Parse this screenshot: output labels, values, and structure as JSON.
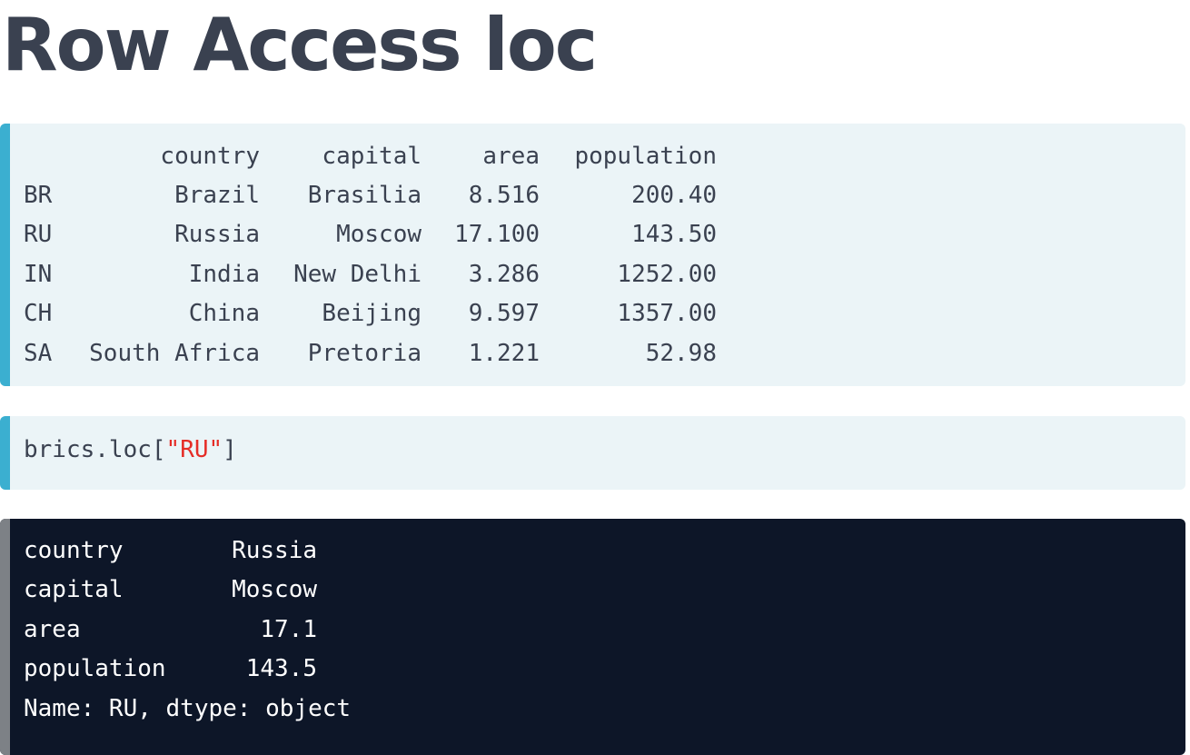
{
  "slide": {
    "title": "Row Access loc"
  },
  "dataframe": {
    "columns": [
      "country",
      "capital",
      "area",
      "population"
    ],
    "rows": [
      {
        "index": "BR",
        "country": "Brazil",
        "capital": "Brasilia",
        "area": "8.516",
        "population": "200.40"
      },
      {
        "index": "RU",
        "country": "Russia",
        "capital": "Moscow",
        "area": "17.100",
        "population": "143.50"
      },
      {
        "index": "IN",
        "country": "India",
        "capital": "New Delhi",
        "area": "3.286",
        "population": "1252.00"
      },
      {
        "index": "CH",
        "country": "China",
        "capital": "Beijing",
        "area": "9.597",
        "population": "1357.00"
      },
      {
        "index": "SA",
        "country": "South Africa",
        "capital": "Pretoria",
        "area": "1.221",
        "population": "52.98"
      }
    ]
  },
  "code": {
    "prefix": "brics.loc[",
    "string": "\"RU\"",
    "suffix": "]"
  },
  "output": {
    "rows": [
      {
        "key": "country",
        "value": "Russia"
      },
      {
        "key": "capital",
        "value": "Moscow"
      },
      {
        "key": "area",
        "value": "17.1"
      },
      {
        "key": "population",
        "value": "143.5"
      }
    ],
    "footer": "Name: RU, dtype: object"
  },
  "colors": {
    "title": "#3a4150",
    "code_bg": "#ebf4f7",
    "code_bar": "#3bafd0",
    "output_bg": "#0d1628",
    "output_bar": "#7d8186",
    "string": "#e52d27"
  }
}
